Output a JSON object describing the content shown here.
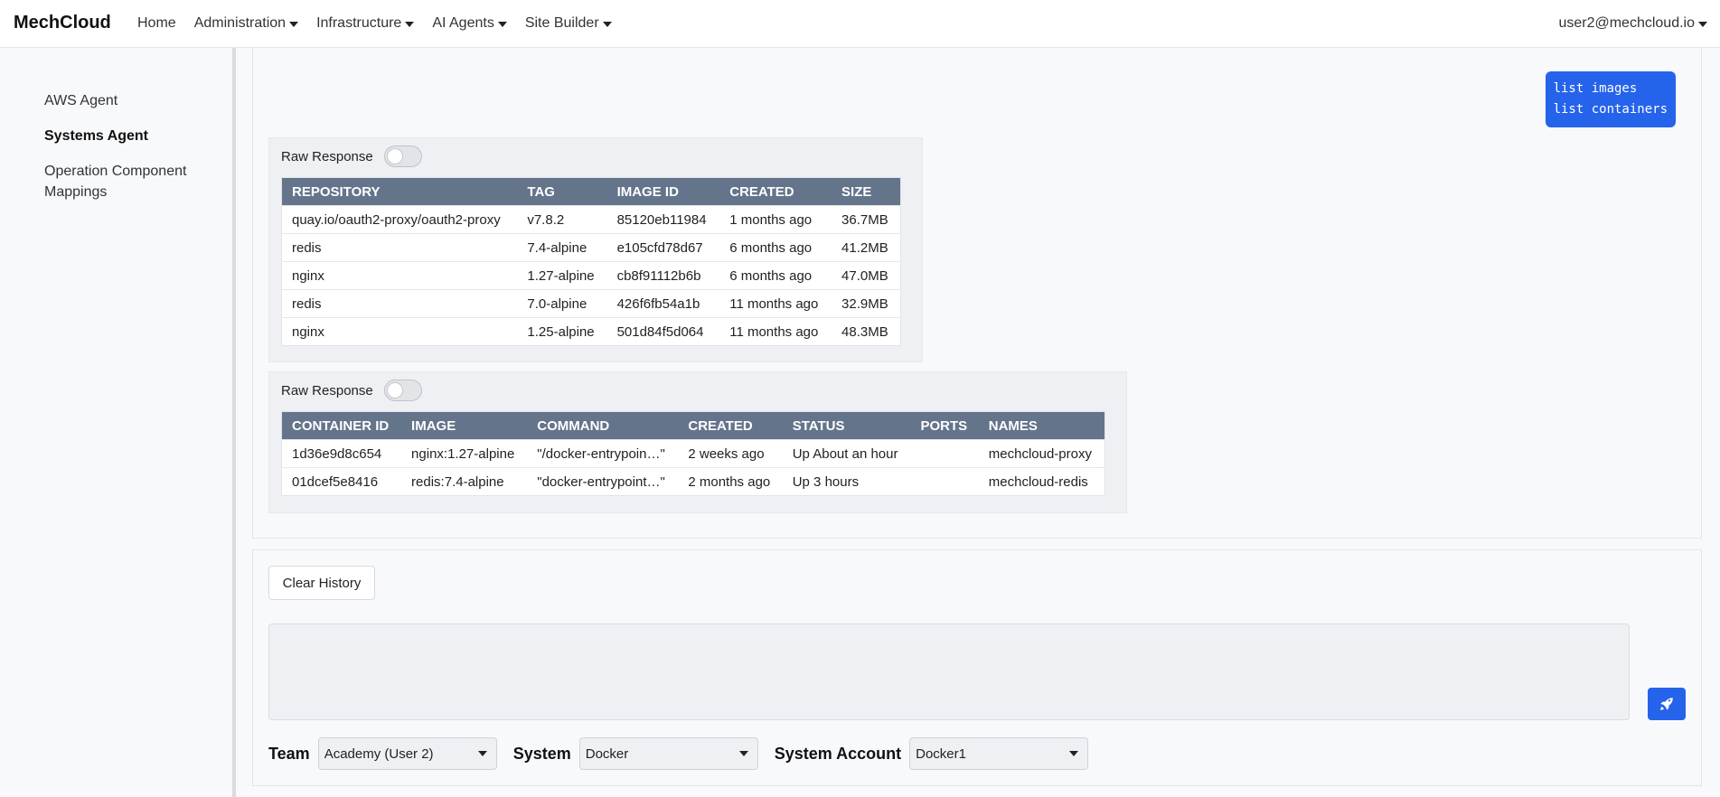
{
  "navbar": {
    "brand": "MechCloud",
    "links": [
      {
        "label": "Home",
        "dropdown": false
      },
      {
        "label": "Administration",
        "dropdown": true
      },
      {
        "label": "Infrastructure",
        "dropdown": true
      },
      {
        "label": "AI Agents",
        "dropdown": true
      },
      {
        "label": "Site Builder",
        "dropdown": true
      }
    ],
    "user": "user2@mechcloud.io"
  },
  "sidebar": {
    "items": [
      {
        "label": "AWS Agent",
        "active": false
      },
      {
        "label": "Systems Agent",
        "active": true
      },
      {
        "label": "Operation Component Mappings",
        "active": false
      }
    ]
  },
  "chat": {
    "user_message": "list images\nlist containers",
    "responses": [
      {
        "raw_label": "Raw Response",
        "raw_enabled": false,
        "columns": [
          "REPOSITORY",
          "TAG",
          "IMAGE ID",
          "CREATED",
          "SIZE"
        ],
        "rows": [
          [
            "quay.io/oauth2-proxy/oauth2-proxy",
            "v7.8.2",
            "85120eb11984",
            "1 months ago",
            "36.7MB"
          ],
          [
            "redis",
            "7.4-alpine",
            "e105cfd78d67",
            "6 months ago",
            "41.2MB"
          ],
          [
            "nginx",
            "1.27-alpine",
            "cb8f91112b6b",
            "6 months ago",
            "47.0MB"
          ],
          [
            "redis",
            "7.0-alpine",
            "426f6fb54a1b",
            "11 months ago",
            "32.9MB"
          ],
          [
            "nginx",
            "1.25-alpine",
            "501d84f5d064",
            "11 months ago",
            "48.3MB"
          ]
        ]
      },
      {
        "raw_label": "Raw Response",
        "raw_enabled": false,
        "columns": [
          "CONTAINER ID",
          "IMAGE",
          "COMMAND",
          "CREATED",
          "STATUS",
          "PORTS",
          "NAMES"
        ],
        "rows": [
          [
            "1d36e9d8c654",
            "nginx:1.27-alpine",
            "\"/docker-entrypoin…\"",
            "2 weeks ago",
            "Up About an hour",
            "",
            "mechcloud-proxy"
          ],
          [
            "01dcef5e8416",
            "redis:7.4-alpine",
            "\"docker-entrypoint…\"",
            "2 months ago",
            "Up 3 hours",
            "",
            "mechcloud-redis"
          ]
        ]
      }
    ]
  },
  "input": {
    "clear_label": "Clear History",
    "prompt_value": "",
    "prompt_placeholder": "",
    "send_icon": "rocket-icon",
    "selectors": [
      {
        "label": "Team",
        "value": "Academy (User 2)"
      },
      {
        "label": "System",
        "value": "Docker"
      },
      {
        "label": "System Account",
        "value": "Docker1"
      }
    ]
  },
  "colors": {
    "accent": "#2563eb",
    "table_header": "#64748b"
  }
}
